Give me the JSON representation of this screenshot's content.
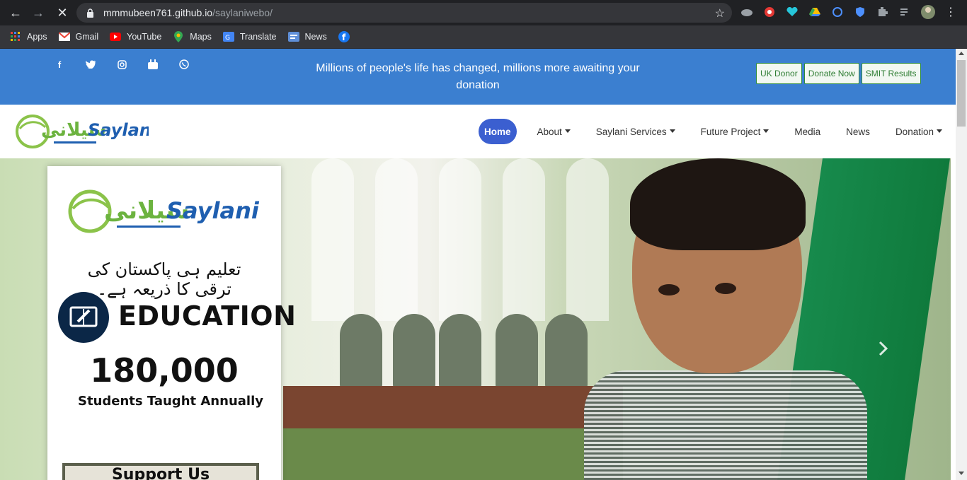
{
  "browser": {
    "url_host": "mmmubeen761.github.io",
    "url_path": "/saylaniwebo/",
    "bookmarks": [
      {
        "label": "Apps",
        "icon": "apps-grid-icon"
      },
      {
        "label": "Gmail",
        "icon": "gmail-icon"
      },
      {
        "label": "YouTube",
        "icon": "youtube-icon"
      },
      {
        "label": "Maps",
        "icon": "maps-icon"
      },
      {
        "label": "Translate",
        "icon": "translate-icon"
      },
      {
        "label": "News",
        "icon": "news-icon"
      }
    ]
  },
  "topbar": {
    "tagline": "Millions of people's life has changed, millions more awaiting your donation",
    "buttons": [
      "UK Donor",
      "Donate Now",
      "SMIT Results"
    ],
    "socials": [
      "facebook-icon",
      "twitter-icon",
      "instagram-icon",
      "youtube-icon",
      "whatsapp-icon"
    ]
  },
  "nav": {
    "items": [
      {
        "label": "Home",
        "active": true,
        "dropdown": false
      },
      {
        "label": "About",
        "dropdown": true
      },
      {
        "label": "Saylani Services",
        "dropdown": true
      },
      {
        "label": "Future Project",
        "dropdown": true
      },
      {
        "label": "Media",
        "dropdown": false
      },
      {
        "label": "News",
        "dropdown": false
      },
      {
        "label": "Donation",
        "dropdown": true
      }
    ]
  },
  "hero": {
    "urdu_line": "تعلیم ہی پاکستان کی ترقی کا ذریعہ ہے۔",
    "category": "EDUCATION",
    "stat_value": "180,000",
    "stat_label": "Students Taught Annually",
    "cta": "Support Us"
  },
  "colors": {
    "topbar": "#3b7fd0",
    "nav_active": "#3b5fd0",
    "button_green": "#2e8b3c",
    "education_navy": "#0b2747"
  }
}
